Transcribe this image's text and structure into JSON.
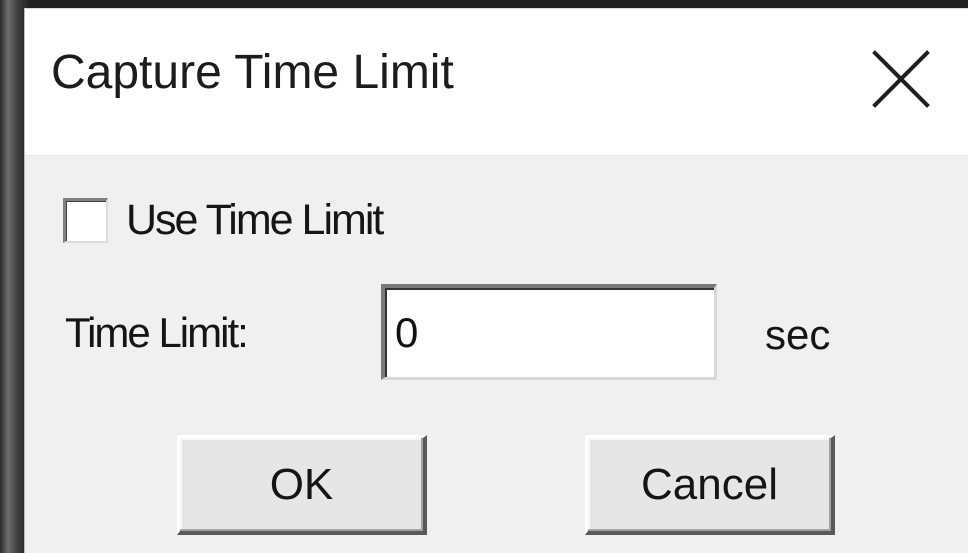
{
  "dialog": {
    "title": "Capture Time Limit",
    "close_icon": "close-icon"
  },
  "options": {
    "use_time_limit_label": "Use Time Limit",
    "use_time_limit_checked": false
  },
  "time_limit": {
    "label": "Time Limit:",
    "value": "0",
    "unit": "sec"
  },
  "buttons": {
    "ok_label": "OK",
    "cancel_label": "Cancel"
  },
  "colors": {
    "dialog_background": "#f0f0f0",
    "titlebar_background": "#ffffff",
    "text": "#151515"
  }
}
